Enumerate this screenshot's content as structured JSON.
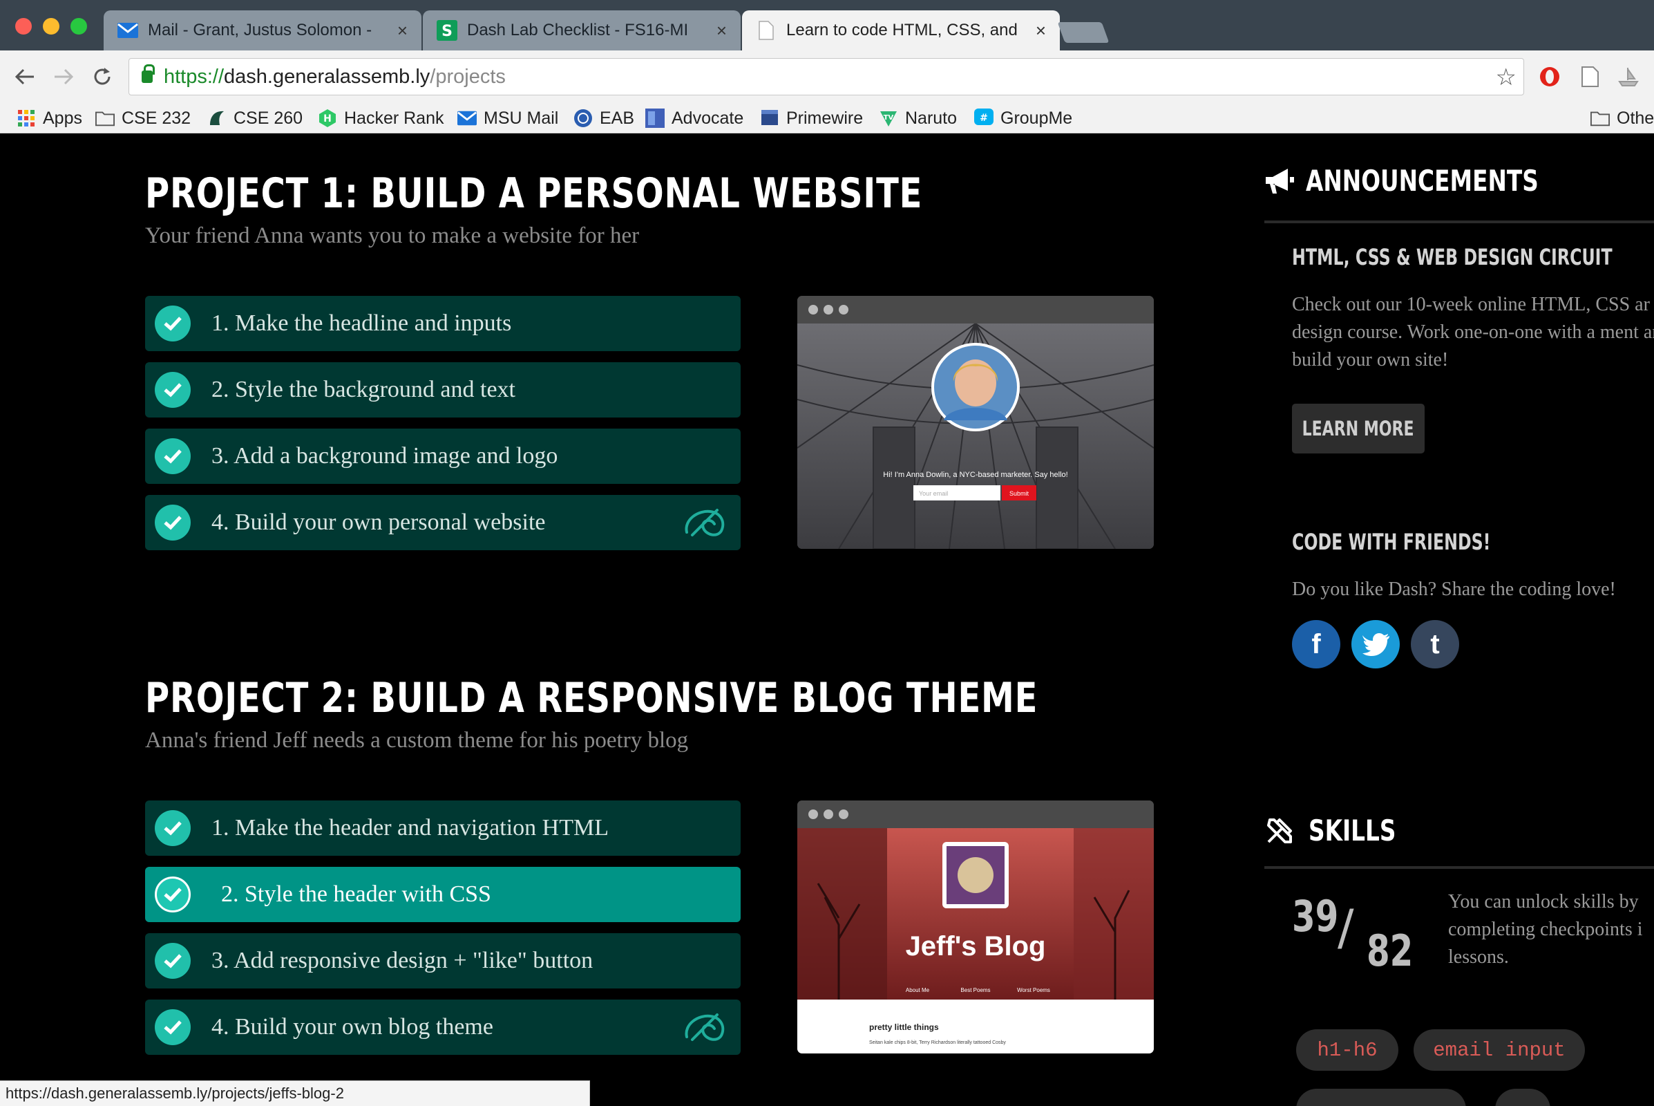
{
  "browser": {
    "tabs": [
      {
        "title": "Mail - Grant, Justus Solomon -",
        "icon": "mail-icon"
      },
      {
        "title": "Dash Lab Checklist - FS16-MI",
        "icon": "spreadsheet-icon"
      },
      {
        "title": "Learn to code HTML, CSS, and",
        "icon": "page-icon"
      }
    ],
    "close_glyph": "×",
    "url": {
      "scheme": "https://",
      "host": "dash.generalassemb.ly",
      "path": "/projects"
    },
    "bookmarks": [
      {
        "label": "Apps",
        "icon": "apps-grid-icon"
      },
      {
        "label": "CSE 232",
        "icon": "folder-icon"
      },
      {
        "label": "CSE 260",
        "icon": "spartan-icon"
      },
      {
        "label": "Hacker Rank",
        "icon": "hackerrank-icon"
      },
      {
        "label": "MSU Mail",
        "icon": "mail-icon"
      },
      {
        "label": "EAB",
        "icon": "eab-icon"
      },
      {
        "label": "Advocate",
        "icon": "advocate-icon"
      },
      {
        "label": "Primewire",
        "icon": "film-icon"
      },
      {
        "label": "Naruto",
        "icon": "tv-icon"
      },
      {
        "label": "GroupMe",
        "icon": "groupme-icon"
      },
      {
        "label": "Othe",
        "icon": "folder-icon"
      }
    ]
  },
  "projects": [
    {
      "title": "PROJECT 1: BUILD A PERSONAL WEBSITE",
      "subtitle": "Your friend Anna wants you to make a website for her",
      "steps": [
        {
          "label": "1. Make the headline and inputs",
          "active": false,
          "badge": false
        },
        {
          "label": "2. Style the background and text",
          "active": false,
          "badge": false
        },
        {
          "label": "3. Add a background image and logo",
          "active": false,
          "badge": false
        },
        {
          "label": "4. Build your own personal website",
          "active": false,
          "badge": true
        }
      ],
      "preview": {
        "tagline": "Hi! I'm Anna Dowlin, a NYC-based marketer. Say hello!",
        "email_placeholder": "Your email",
        "submit_label": "Submit"
      }
    },
    {
      "title": "PROJECT 2: BUILD A RESPONSIVE BLOG THEME",
      "subtitle": "Anna's friend Jeff needs a custom theme for his poetry blog",
      "steps": [
        {
          "label": "1. Make the header and navigation HTML",
          "active": false,
          "badge": false
        },
        {
          "label": "2. Style the header with CSS",
          "active": true,
          "badge": false
        },
        {
          "label": "3. Add responsive design + \"like\" button",
          "active": false,
          "badge": false
        },
        {
          "label": "4. Build your own blog theme",
          "active": false,
          "badge": true
        }
      ],
      "preview": {
        "blog_title": "Jeff's Blog",
        "nav": [
          "About Me",
          "Best Poems",
          "Worst Poems"
        ],
        "post_title": "pretty little things",
        "post_excerpt": "Seitan kale chips 8-bit, Terry Richardson literally tattooed Cosby"
      }
    }
  ],
  "sidebar": {
    "announcements": {
      "heading": "ANNOUNCEMENTS",
      "item_title": "HTML, CSS & WEB DESIGN CIRCUIT",
      "item_text": "Check out our 10-week online HTML, CSS ar design course. Work one-on-one with a ment and build your own site!",
      "button": "LEARN MORE"
    },
    "friends": {
      "title": "CODE WITH FRIENDS!",
      "text": "Do you like Dash? Share the coding love!",
      "networks": [
        {
          "glyph": "f",
          "name": "facebook",
          "color": "#1b5fa8"
        },
        {
          "glyph": "t",
          "name": "twitter",
          "color": "#1a9bd9"
        },
        {
          "glyph": "t",
          "name": "tumblr",
          "color": "#36465d"
        }
      ]
    },
    "skills": {
      "heading": "SKILLS",
      "unlocked": "39",
      "slash": "/",
      "total": "82",
      "text": "You can unlock skills by completing checkpoints i lessons.",
      "tags": [
        "h1-h6",
        "email input"
      ]
    }
  },
  "status_url": "https://dash.generalassemb.ly/projects/jeffs-blog-2",
  "colors": {
    "accent": "#009486",
    "step_bg": "#003832",
    "check": "#21c0ab",
    "tag_text": "#d95b57"
  }
}
